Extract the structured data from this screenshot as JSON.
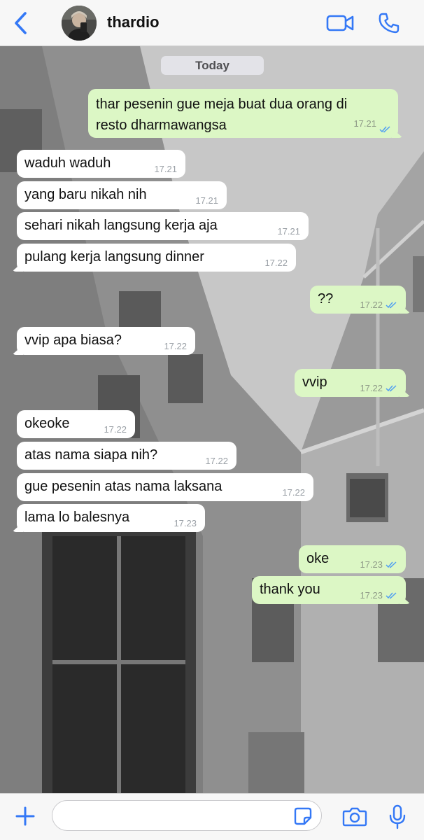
{
  "colors": {
    "accent": "#3478f6",
    "incoming_bubble": "#ffffff",
    "outgoing_bubble": "#dcf7c5",
    "read_ticks": "#4f9ef2",
    "date_pill": "#e3e3e8"
  },
  "header": {
    "contact_name": "thardio",
    "back_icon": "chevron-left-icon",
    "video_icon": "video-camera-icon",
    "call_icon": "phone-icon"
  },
  "chat": {
    "date_label": "Today",
    "messages": [
      {
        "dir": "out",
        "line1": "thar pesenin gue meja buat dua orang di",
        "line2": "resto dharmawangsa",
        "time": "17.21",
        "status": "read"
      },
      {
        "dir": "in",
        "text": "waduh waduh",
        "time": "17.21"
      },
      {
        "dir": "in",
        "text": "yang baru nikah nih",
        "time": "17.21"
      },
      {
        "dir": "in",
        "text": "sehari nikah langsung kerja aja",
        "time": "17.21"
      },
      {
        "dir": "in",
        "text": "pulang kerja langsung dinner",
        "time": "17.22"
      },
      {
        "dir": "out",
        "text": "??",
        "time": "17.22",
        "status": "read"
      },
      {
        "dir": "in",
        "text": "vvip apa biasa?",
        "time": "17.22"
      },
      {
        "dir": "out",
        "text": "vvip",
        "time": "17.22",
        "status": "read"
      },
      {
        "dir": "in",
        "text": "okeoke",
        "time": "17.22"
      },
      {
        "dir": "in",
        "text": "atas nama siapa nih?",
        "time": "17.22"
      },
      {
        "dir": "in",
        "text": "gue pesenin atas nama laksana",
        "time": "17.22"
      },
      {
        "dir": "in",
        "text": "lama lo balesnya",
        "time": "17.23"
      },
      {
        "dir": "out",
        "text": "oke",
        "time": "17.23",
        "status": "read"
      },
      {
        "dir": "out",
        "text": "thank you",
        "time": "17.23",
        "status": "read"
      }
    ]
  },
  "footer": {
    "message_value": "",
    "plus_icon": "plus-icon",
    "sticker_icon": "sticker-icon",
    "camera_icon": "camera-icon",
    "mic_icon": "microphone-icon"
  }
}
